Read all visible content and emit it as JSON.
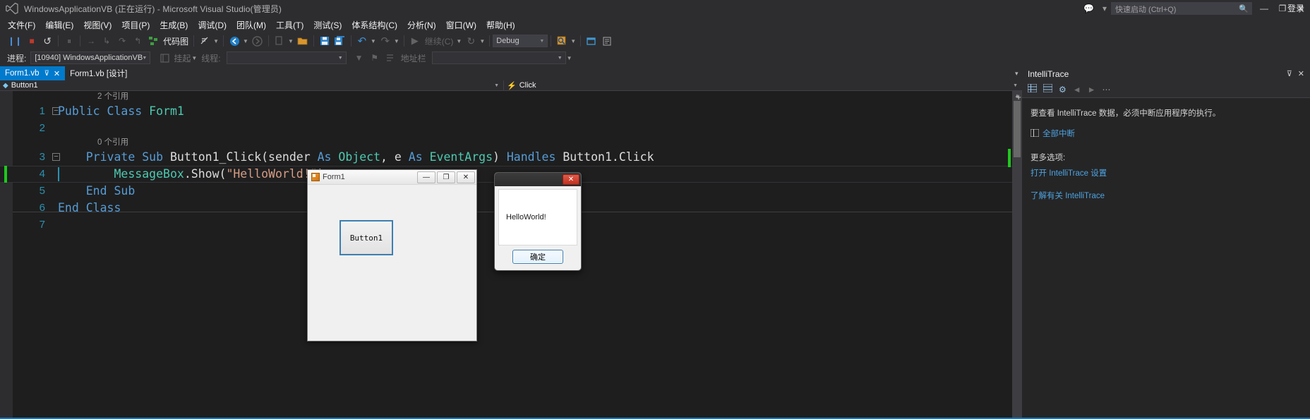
{
  "titlebar": {
    "title": "WindowsApplicationVB (正在运行) - Microsoft Visual Studio(管理员)",
    "quick_launch_placeholder": "快速启动 (Ctrl+Q)",
    "search_icon": "search-icon",
    "feedback_icon": "feedback-icon",
    "filter_icon": "filter-icon",
    "minimize": "—",
    "maximize": "❐",
    "close": "✕"
  },
  "menubar": {
    "items": [
      "文件(F)",
      "编辑(E)",
      "视图(V)",
      "项目(P)",
      "生成(B)",
      "调试(D)",
      "团队(M)",
      "工具(T)",
      "测试(S)",
      "体系结构(C)",
      "分析(N)",
      "窗口(W)",
      "帮助(H)"
    ],
    "signin": "登录"
  },
  "toolbar": {
    "pause": "❙❙",
    "stop": "■",
    "restart": "↺",
    "break_all": "⏸",
    "show_next": "→",
    "step_into": "↳",
    "step_over": "↷",
    "step_out": "↰",
    "code_map_label": "代码图",
    "code_map_icon": "code-map-icon",
    "no_source_icon": "no-source-icon",
    "nav_back": "←",
    "nav_forward": "→",
    "undo_nav_icon": "undo-nav-icon",
    "new_item_icon": "new-item-icon",
    "save_icon": "save-icon",
    "save_all_icon": "save-all-icon",
    "undo": "↶",
    "redo": "↷",
    "start_icon": "▶",
    "start_label": "继续(C)",
    "reload_icon": "↻",
    "config_value": "Debug",
    "find_icon": "find-icon",
    "window_icon": "window-icon",
    "properties_icon": "properties-icon"
  },
  "debugbar": {
    "process_label": "进程:",
    "process_value": "[10940] WindowsApplicationVB",
    "suspend_icon": "suspend-icon",
    "suspend_label": "挂起",
    "thread_label": "线程:",
    "thread_value": "",
    "stackframe_value": "",
    "address_label": "地址栏"
  },
  "tabs": [
    {
      "label": "Form1.vb",
      "active": true,
      "pin": "⊽",
      "close": "✕"
    },
    {
      "label": "Form1.vb [设计]",
      "active": false
    }
  ],
  "navbar": {
    "left_icon": "class-cube-icon",
    "left_value": "Button1",
    "right_icon": "event-bolt-icon",
    "right_value": "Click",
    "dropdown_arrow": "▼"
  },
  "code": {
    "ref_class": "2 个引用",
    "ref_method": "0 个引用",
    "lines": [
      {
        "no": "1",
        "fold": "⊟",
        "tokens": [
          {
            "t": "Public ",
            "c": "k-kw"
          },
          {
            "t": "Class ",
            "c": "k-kw"
          },
          {
            "t": "Form1",
            "c": "k-type"
          }
        ]
      },
      {
        "no": "2",
        "fold": "",
        "tokens": []
      },
      {
        "no": "3",
        "fold": "⊟",
        "indent": "    ",
        "tokens": [
          {
            "t": "Private ",
            "c": "k-kw"
          },
          {
            "t": "Sub ",
            "c": "k-kw"
          },
          {
            "t": "Button1_Click",
            "c": "k-plain"
          },
          {
            "t": "(sender ",
            "c": "k-plain"
          },
          {
            "t": "As ",
            "c": "k-kw"
          },
          {
            "t": "Object",
            "c": "k-type"
          },
          {
            "t": ", e ",
            "c": "k-plain"
          },
          {
            "t": "As ",
            "c": "k-kw"
          },
          {
            "t": "EventArgs",
            "c": "k-type"
          },
          {
            "t": ") ",
            "c": "k-plain"
          },
          {
            "t": "Handles ",
            "c": "k-kw"
          },
          {
            "t": "Button1.Click",
            "c": "k-plain"
          }
        ]
      },
      {
        "no": "4",
        "fold": "",
        "indent": "        ",
        "current": true,
        "tokens": [
          {
            "t": "MessageBox",
            "c": "k-type"
          },
          {
            "t": ".Show(",
            "c": "k-plain"
          },
          {
            "t": "\"HelloWorld!\"",
            "c": "k-str"
          },
          {
            "t": ")",
            "c": "k-plain"
          }
        ]
      },
      {
        "no": "5",
        "fold": "",
        "indent": "    ",
        "tokens": [
          {
            "t": "End ",
            "c": "k-kw"
          },
          {
            "t": "Sub",
            "c": "k-kw"
          }
        ]
      },
      {
        "no": "6",
        "fold": "",
        "tokens": [
          {
            "t": "End ",
            "c": "k-kw"
          },
          {
            "t": "Class",
            "c": "k-kw"
          }
        ]
      },
      {
        "no": "7",
        "fold": "",
        "tokens": []
      }
    ]
  },
  "intellitrace": {
    "title": "IntelliTrace",
    "pin": "⊽",
    "close": "✕",
    "toolbar_icons": [
      "list-view-icon",
      "detail-view-icon",
      "gear-icon",
      "back-arrow-icon",
      "forward-arrow-icon",
      "overflow-icon"
    ],
    "description": "要查看 IntelliTrace 数据，必须中断应用程序的执行。",
    "break_all_icon": "break-all-icon",
    "break_all_label": "全部中断",
    "more_options_label": "更多选项:",
    "links": [
      "打开 IntelliTrace 设置",
      "了解有关 IntelliTrace"
    ]
  },
  "form1_window": {
    "caption": "Form1",
    "icon": "vb-form-icon",
    "minimize": "—",
    "maximize": "❐",
    "close": "✕",
    "button_label": "Button1"
  },
  "messagebox": {
    "close": "✕",
    "message": "HelloWorld!",
    "ok_label": "确定"
  }
}
